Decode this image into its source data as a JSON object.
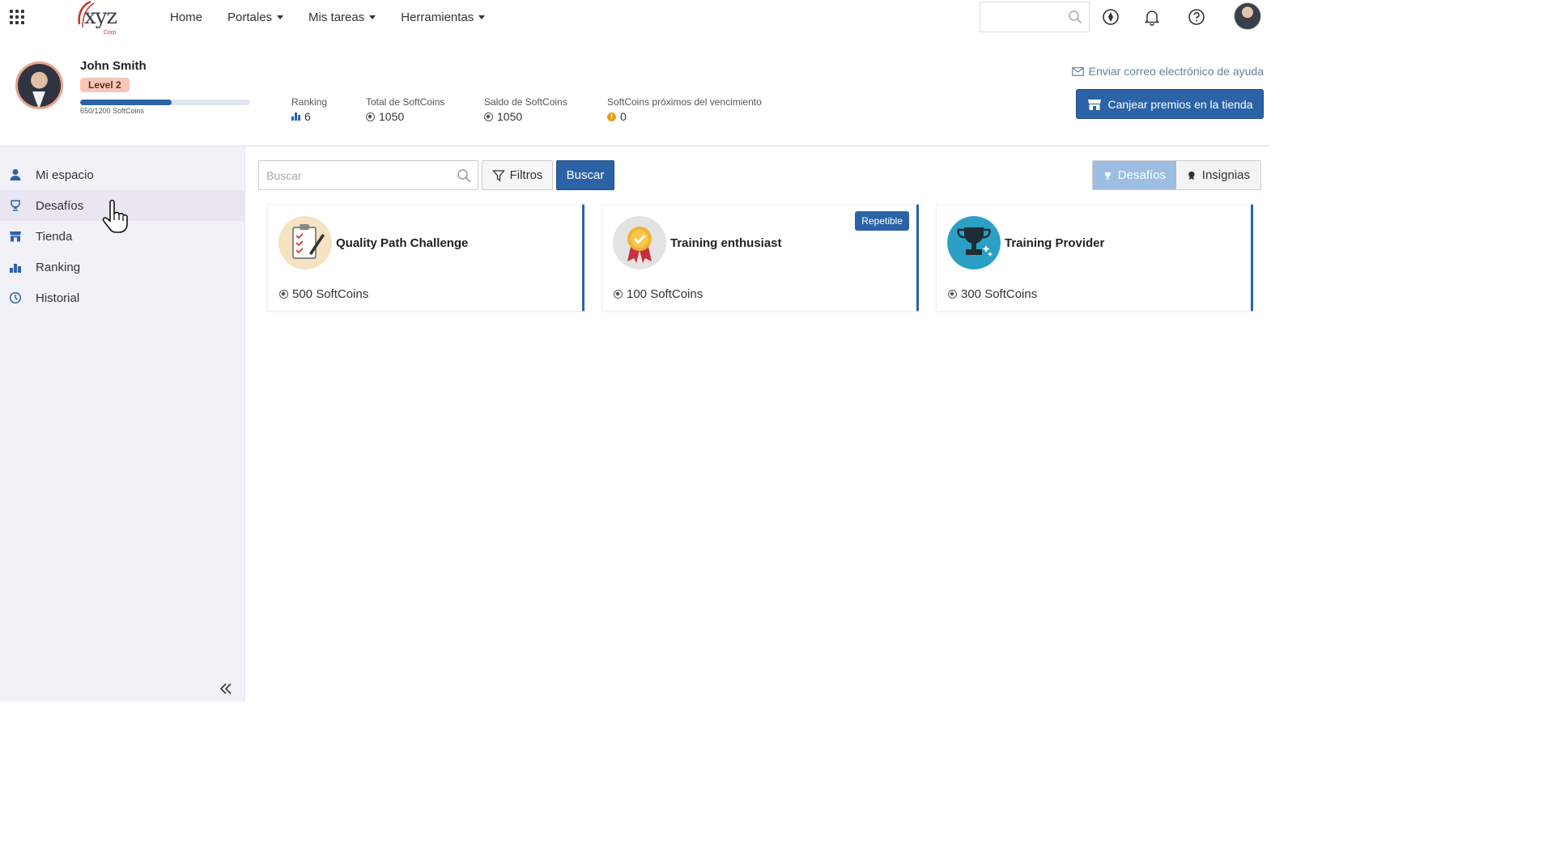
{
  "nav": {
    "logo_text": "xyz",
    "logo_sub": "Corp.",
    "items": [
      {
        "label": "Home"
      },
      {
        "label": "Portales"
      },
      {
        "label": "Mis tareas"
      },
      {
        "label": "Herramientas"
      }
    ],
    "search_placeholder": ""
  },
  "profile": {
    "name": "John Smith",
    "level": "Level 2",
    "progress_text": "650/1200 SoftCoins",
    "progress_fraction": 0.54,
    "stats": [
      {
        "label": "Ranking",
        "value": "6",
        "icon": "ranking-icon"
      },
      {
        "label": "Total de SoftCoins",
        "value": "1050",
        "icon": "softcoin-icon"
      },
      {
        "label": "Saldo de SoftCoins",
        "value": "1050",
        "icon": "softcoin-icon"
      },
      {
        "label": "SoftCoins próximos del vencimiento",
        "value": "0",
        "icon": "warning-coin-icon"
      }
    ],
    "help_link": "Enviar correo electrónico de ayuda",
    "redeem_button": "Canjear premios en la tienda"
  },
  "sidebar": {
    "items": [
      {
        "label": "Mi espacio",
        "icon": "user-icon"
      },
      {
        "label": "Desafíos",
        "icon": "trophy-icon",
        "active": true
      },
      {
        "label": "Tienda",
        "icon": "store-icon"
      },
      {
        "label": "Ranking",
        "icon": "ranking-icon"
      },
      {
        "label": "Historial",
        "icon": "history-icon"
      }
    ]
  },
  "main": {
    "search_placeholder": "Buscar",
    "filter_button": "Filtros",
    "search_button": "Buscar",
    "toggle": {
      "active": "Desafíos",
      "inactive": "Insignias"
    },
    "cards": [
      {
        "title": "Quality Path Challenge",
        "coins": "500 SoftCoins",
        "badge": ""
      },
      {
        "title": "Training enthusiast",
        "coins": "100 SoftCoins",
        "badge": "Repetible"
      },
      {
        "title": "Training Provider",
        "coins": "300 SoftCoins",
        "badge": ""
      }
    ]
  },
  "colors": {
    "primary": "#2b63a6",
    "toggle_active": "#9dbde2",
    "sidebar_bg": "#f3f1f8",
    "level_badge": "#f6c7b8"
  }
}
